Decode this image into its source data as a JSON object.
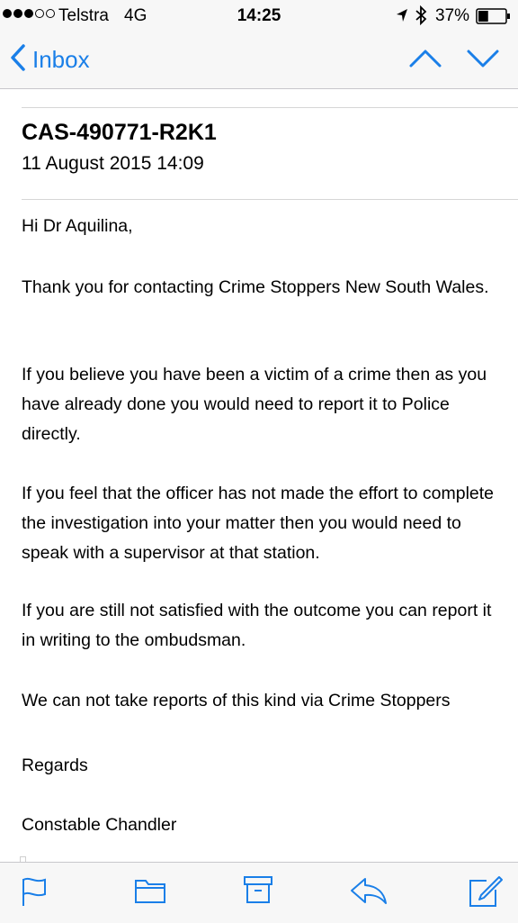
{
  "status_bar": {
    "carrier": "Telstra",
    "network": "4G",
    "time": "14:25",
    "battery_percent": "37%",
    "battery_level": 0.37,
    "signal_bars_filled": 3,
    "signal_bars_total": 5,
    "icons": [
      "location-arrow-icon",
      "bluetooth-icon",
      "battery-icon"
    ]
  },
  "nav": {
    "back_label": "Inbox",
    "icons": [
      "chevron-left-icon",
      "chevron-up-icon",
      "chevron-down-icon"
    ]
  },
  "message": {
    "subject": "CAS-490771-R2K1",
    "date": "11 August 2015 14:09",
    "greeting": "Hi Dr Aquilina,",
    "paragraph_1": "Thank you for contacting Crime Stoppers New South Wales.",
    "paragraph_2": "If you believe you have been a victim of a crime then as you have already done you would need to report it to Police directly.",
    "paragraph_3": "If you feel that the officer has not made the effort to complete the investigation into your matter then you would need to speak with a supervisor at that station.",
    "paragraph_4": "If you are still not satisfied with the outcome you can report it in writing to the ombudsman.",
    "paragraph_5": "We can not take reports of this kind via Crime Stoppers",
    "closing": "Regards",
    "signature": "Constable Chandler"
  },
  "toolbar": {
    "icons": [
      "flag-icon",
      "folder-icon",
      "archive-icon",
      "reply-icon",
      "compose-icon"
    ]
  },
  "colors": {
    "accent": "#1a7fe8",
    "bar_background": "#f7f7f7",
    "divider": "#c8c7cc"
  }
}
